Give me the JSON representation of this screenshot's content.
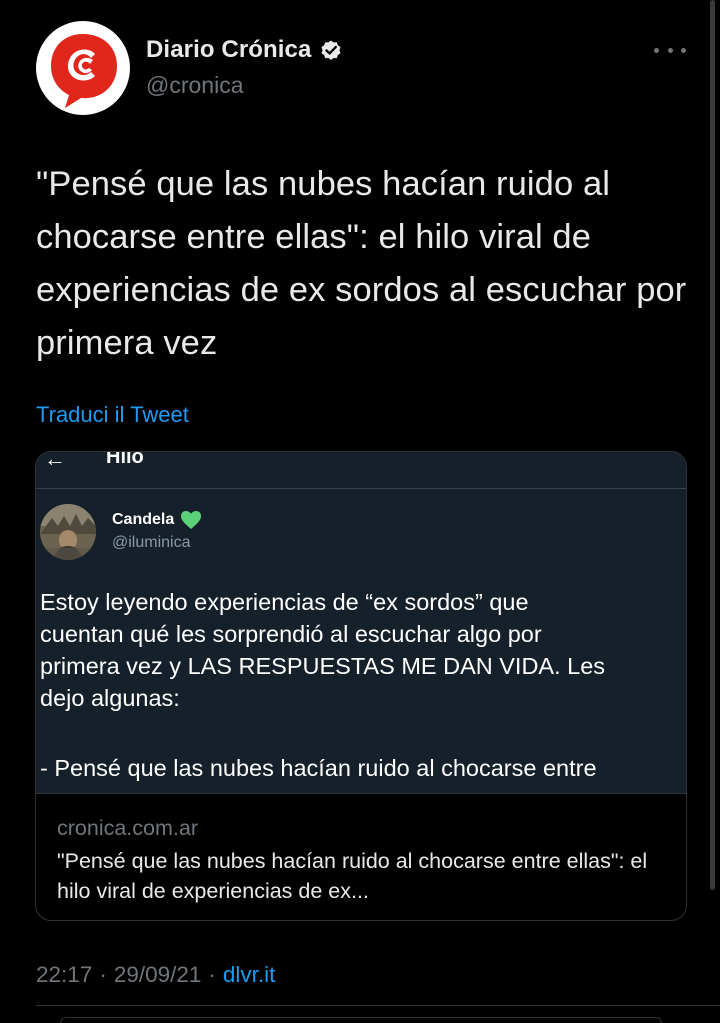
{
  "author": {
    "display_name": "Diario Crónica",
    "handle": "@cronica",
    "verified_icon": "verified-badge-icon",
    "avatar_icon": "cronica-logo-icon",
    "brand_color": "#e1261c"
  },
  "tweet": {
    "text": "\"Pensé que las nubes hacían ruido al chocarse entre ellas\": el hilo viral de experiencias de ex sordos al escuchar por primera vez",
    "translate_label": "Traduci il Tweet",
    "time": "22:17",
    "separator": "·",
    "date": "29/09/21",
    "source": "dlvr.it"
  },
  "card": {
    "domain": "cronica.com.ar",
    "title": "\"Pensé que las nubes hacían ruido al chocarse entre ellas\": el hilo viral de experiencias de ex...",
    "image": {
      "back_arrow": "←",
      "header": "Hilo",
      "author_name": "Candela",
      "author_handle": "@iluminica",
      "heart_icon": "green-heart-icon",
      "body": "Estoy leyendo experiencias de “ex sordos” que\ncuentan qué les sorprendió al escuchar algo por\nprimera vez y LAS RESPUESTAS ME DAN VIDA. Les\ndejo algunas:",
      "body_cut": "- Pensé que las nubes hacían ruido al chocarse entre"
    }
  },
  "colors": {
    "background": "#000000",
    "text_primary": "#e7e9ea",
    "text_secondary": "#71767b",
    "link": "#1d9bf0"
  }
}
